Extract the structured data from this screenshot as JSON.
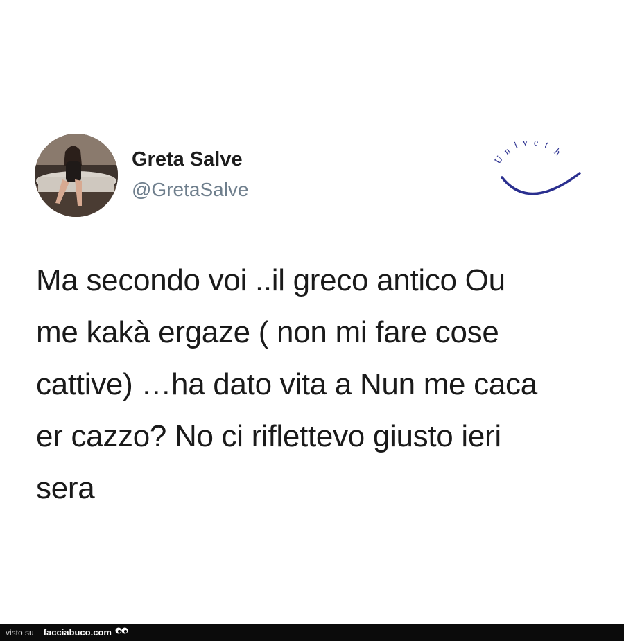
{
  "tweet": {
    "author_name": "Greta Salve",
    "author_handle": "@GretaSalve",
    "text_lines": [
      "Ma secondo voi ..il greco antico Ou",
      "me kakà ergaze ( non mi fare cose",
      "cattive) …ha dato vita a Nun me caca",
      "er cazzo? No ci riflettevo giusto ieri",
      "sera"
    ]
  },
  "watermark": {
    "logo_text": "Univeth",
    "icon": "smile-arc-logo"
  },
  "footer": {
    "prefix": "visto su",
    "site": "facciabuco.com",
    "icon": "eyes-icon"
  }
}
